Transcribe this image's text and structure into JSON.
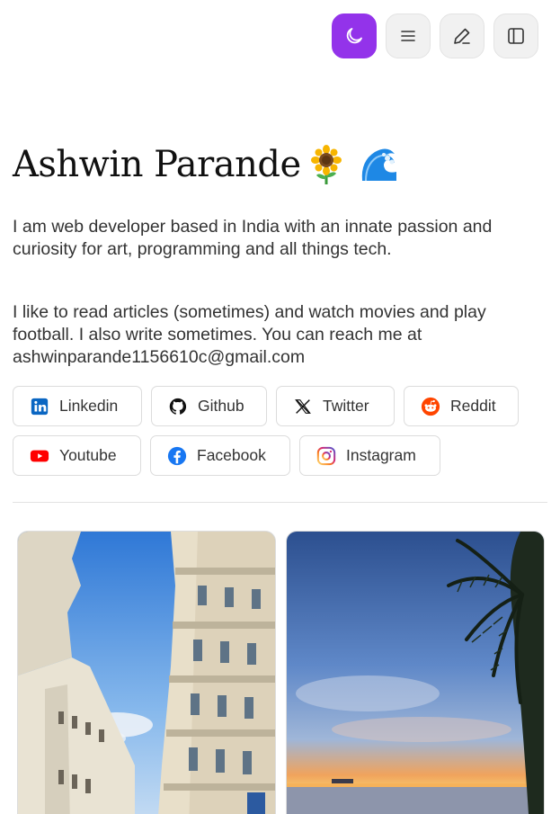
{
  "header": {
    "theme_toggle_icon": "moon-icon",
    "menu_icon": "menu-icon",
    "edit_icon": "pencil-icon",
    "sidebar_icon": "sidebar-icon",
    "accent": "#9333ea"
  },
  "profile": {
    "name": "Ashwin Parande",
    "emoji_1": "sunflower",
    "emoji_2": "water-wave",
    "bio_1": "I am web developer based in India with an innate passion and curiosity for art, programming and all things tech.",
    "bio_2": "I like to read articles (sometimes) and watch movies and play football. I also write sometimes. You can reach me at ashwinparande1156610c@gmail.com"
  },
  "socials": [
    {
      "label": "Linkedin",
      "icon": "linkedin-icon",
      "color": "#0a66c2"
    },
    {
      "label": "Github",
      "icon": "github-icon",
      "color": "#111111"
    },
    {
      "label": "Twitter",
      "icon": "x-icon",
      "color": "#111111"
    },
    {
      "label": "Reddit",
      "icon": "reddit-icon",
      "color": "#ff4500"
    },
    {
      "label": "Youtube",
      "icon": "youtube-icon",
      "color": "#ff0000"
    },
    {
      "label": "Facebook",
      "icon": "facebook-icon",
      "color": "#1877f2"
    },
    {
      "label": "Instagram",
      "icon": "instagram-icon",
      "color": "#e1306c"
    }
  ],
  "gallery": [
    {
      "subject": "buildings"
    },
    {
      "subject": "sunset-beach"
    }
  ]
}
